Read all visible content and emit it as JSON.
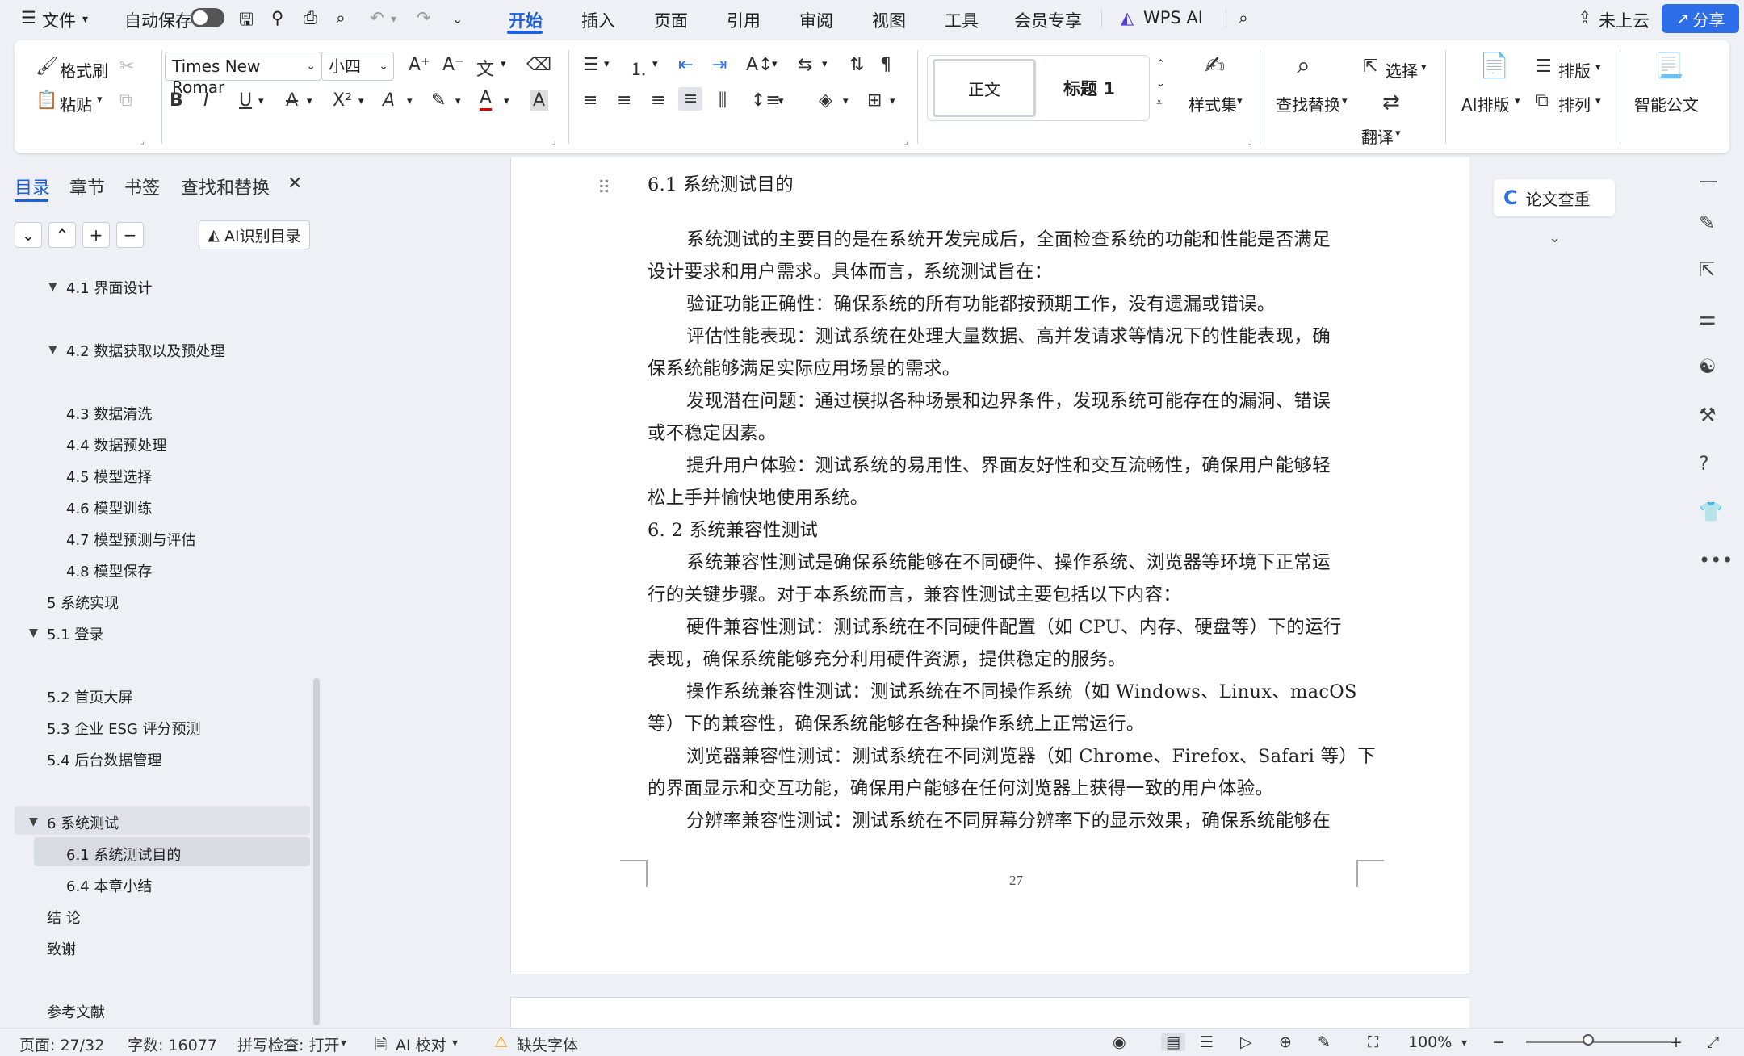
{
  "menubar": {
    "file": "文件",
    "autosave": "自动保存",
    "tabs": [
      "开始",
      "插入",
      "页面",
      "引用",
      "审阅",
      "视图",
      "工具",
      "会员专享"
    ],
    "wps_ai": "WPS AI",
    "cloud": "未上云",
    "share": "分享"
  },
  "ribbon": {
    "format_painter": "格式刷",
    "paste": "粘贴",
    "font_name": "Times New Romar",
    "font_size": "小四",
    "style_normal": "正文",
    "style_heading": "标题 1",
    "style_set": "样式集",
    "find_replace": "查找替换",
    "select": "选择",
    "translate": "翻译",
    "ai_layout": "AI排版",
    "layout": "排版",
    "arrange": "排列",
    "smart_doc": "智能公文"
  },
  "leftpanel": {
    "tabs": [
      "目录",
      "章节",
      "书签",
      "查找和替换"
    ],
    "ai_toc": "AI识别目录",
    "toc": [
      {
        "label": "4.1  界面设计"
      },
      {
        "label": "4.2 数据获取以及预处理"
      },
      {
        "label": "4.3 数据清洗"
      },
      {
        "label": "4.4  数据预处理"
      },
      {
        "label": "4.5  模型选择"
      },
      {
        "label": "4.6  模型训练"
      },
      {
        "label": "4.7  模型预测与评估"
      },
      {
        "label": "4.8  模型保存"
      },
      {
        "label": "5 系统实现"
      },
      {
        "label": "5.1  登录"
      },
      {
        "label": "5.2  首页大屏"
      },
      {
        "label": "5.3  企业 ESG 评分预测"
      },
      {
        "label": "5.4  后台数据管理"
      },
      {
        "label": "6  系统测试"
      },
      {
        "label": "6.1  系统测试目的"
      },
      {
        "label": "6.4  本章小结"
      },
      {
        "label": "结   论"
      },
      {
        "label": "致谢"
      },
      {
        "label": "参考文献"
      }
    ]
  },
  "document": {
    "lines": [
      "6.1  系统测试目的",
      "系统测试的主要目的是在系统开发完成后，全面检查系统的功能和性能是否满足",
      "设计要求和用户需求。具体而言，系统测试旨在：",
      "验证功能正确性：确保系统的所有功能都按预期工作，没有遗漏或错误。",
      "评估性能表现：测试系统在处理大量数据、高并发请求等情况下的性能表现，确",
      "保系统能够满足实际应用场景的需求。",
      "发现潜在问题：通过模拟各种场景和边界条件，发现系统可能存在的漏洞、错误",
      "或不稳定因素。",
      "提升用户体验：测试系统的易用性、界面友好性和交互流畅性，确保用户能够轻",
      "松上手并愉快地使用系统。",
      "6. 2  系统兼容性测试",
      "系统兼容性测试是确保系统能够在不同硬件、操作系统、浏览器等环境下正常运",
      "行的关键步骤。对于本系统而言，兼容性测试主要包括以下内容：",
      "硬件兼容性测试：测试系统在不同硬件配置（如 CPU、内存、硬盘等）下的运行",
      "表现，确保系统能够充分利用硬件资源，提供稳定的服务。",
      "操作系统兼容性测试：测试系统在不同操作系统（如 Windows、Linux、macOS",
      "等）下的兼容性，确保系统能够在各种操作系统上正常运行。",
      "浏览器兼容性测试：测试系统在不同浏览器（如 Chrome、Firefox、Safari 等）下",
      "的界面显示和交互功能，确保用户能够在任何浏览器上获得一致的用户体验。",
      "分辨率兼容性测试：测试系统在不同屏幕分辨率下的显示效果，确保系统能够在"
    ],
    "page_number": "27"
  },
  "rightpanel": {
    "paper_check": "论文查重"
  },
  "statusbar": {
    "page": "页面: 27/32",
    "words": "字数: 16077",
    "spell": "拼写检查: 打开",
    "ai_proof": "AI 校对",
    "missing_font": "缺失字体",
    "zoom": "100%"
  },
  "colors": {
    "accent": "#1f5fd9",
    "share_bg": "#2d6ee8",
    "warning": "#f0a020"
  }
}
